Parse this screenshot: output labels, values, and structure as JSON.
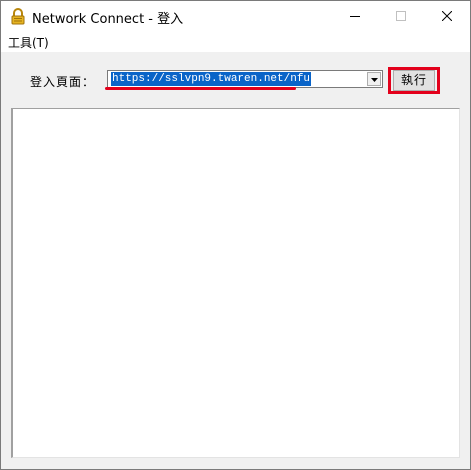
{
  "window": {
    "title": "Network Connect - 登入",
    "icon": "lock-icon"
  },
  "menu": {
    "tools": "工具(T)"
  },
  "form": {
    "login_label": "登入頁面：",
    "url_value": "https://sslvpn9.twaren.net/nfu",
    "execute_label": "執行"
  },
  "colors": {
    "highlight_red": "#e3001b",
    "selection_blue": "#0a64c8",
    "icon_gold": "#d9a520"
  }
}
